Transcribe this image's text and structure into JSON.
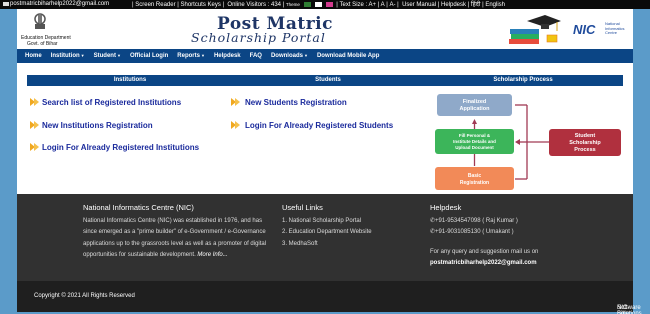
{
  "topbar": {
    "email": "postmatricbiharhelp2022@gmail.com",
    "screen_reader": "Screen Reader",
    "shortcut_keys": "Shortcuts Keys",
    "online_visitors": "Online Visitors : 434",
    "theme_label": "Theme",
    "theme_colors": [
      "#2e7d32",
      "#ffffff",
      "#d43b8f"
    ],
    "text_size": "Text Size : A+ | A",
    "text_size_minus": "A-",
    "user_manual": "User Manual",
    "helpdesk": "Helpdesk",
    "hindi": "हिंदी",
    "english": "English"
  },
  "header": {
    "department_line1": "Education Department",
    "department_line2": "Govt. of Bihar",
    "title_line1": "Post Matric",
    "title_line2": "Scholarship Portal",
    "nic_short": "NIC",
    "nic_full1": "National",
    "nic_full2": "Informatics",
    "nic_full3": "Centre"
  },
  "nav": {
    "items": [
      {
        "label": "Home",
        "caret": false
      },
      {
        "label": "Institution",
        "caret": true
      },
      {
        "label": "Student",
        "caret": true
      },
      {
        "label": "Official Login",
        "caret": false
      },
      {
        "label": "Reports",
        "caret": true
      },
      {
        "label": "Helpdesk",
        "caret": false
      },
      {
        "label": "FAQ",
        "caret": false
      },
      {
        "label": "Downloads",
        "caret": true
      },
      {
        "label": "Download Mobile App",
        "caret": false
      }
    ]
  },
  "institutions": {
    "heading": "Institutions",
    "links": [
      "Search list of Registered Institutions",
      "New Institutions Registration",
      "Login For Already Registered Institutions"
    ]
  },
  "students": {
    "heading": "Students",
    "links": [
      "New Students Registration",
      "Login For Already Registered Students"
    ]
  },
  "process": {
    "heading": "Scholarship Process",
    "finalized": [
      "Finalized",
      "Application"
    ],
    "fill": [
      "Fill Personal &",
      "Institute Details and",
      "Upload Document"
    ],
    "basic": [
      "Basic",
      "Registration"
    ],
    "student": [
      "Student",
      "Scholarship",
      "Process"
    ],
    "colors": {
      "finalized": "#8fa9c9",
      "fill": "#3cb55a",
      "basic": "#f28a58",
      "student": "#b0303e",
      "arrow": "#a13a55"
    }
  },
  "footer": {
    "nic_heading": "National Informatics Centre (NIC)",
    "nic_lines": [
      "National Informatics Centre (NIC) was established in 1976, and has",
      "since emerged as a \"prime builder\" of e-Government / e-Governance",
      "applications up to the grassroots level as well as a promoter of digital",
      "opportunities for sustainable development."
    ],
    "more_info": "More Info...",
    "useful_heading": "Useful Links",
    "useful_links": [
      "1. National Scholarship Portal",
      "2. Education Department Website",
      "3. MedhaSoft"
    ],
    "helpdesk_heading": "Helpdesk",
    "phones": [
      "+91-9534547098 ( Raj Kumar )",
      "+91-9031085130 ( Umakant )"
    ],
    "query_text": "For any query and suggestion mail us on",
    "query_email": "postmatricbiharhelp2022@gmail.com"
  },
  "copyright": {
    "text": "Copyright © 2021 All Rights Reserved",
    "provider_prefix": "Software Solutions Provided by",
    "provider_name": "NIC-Bihar"
  }
}
